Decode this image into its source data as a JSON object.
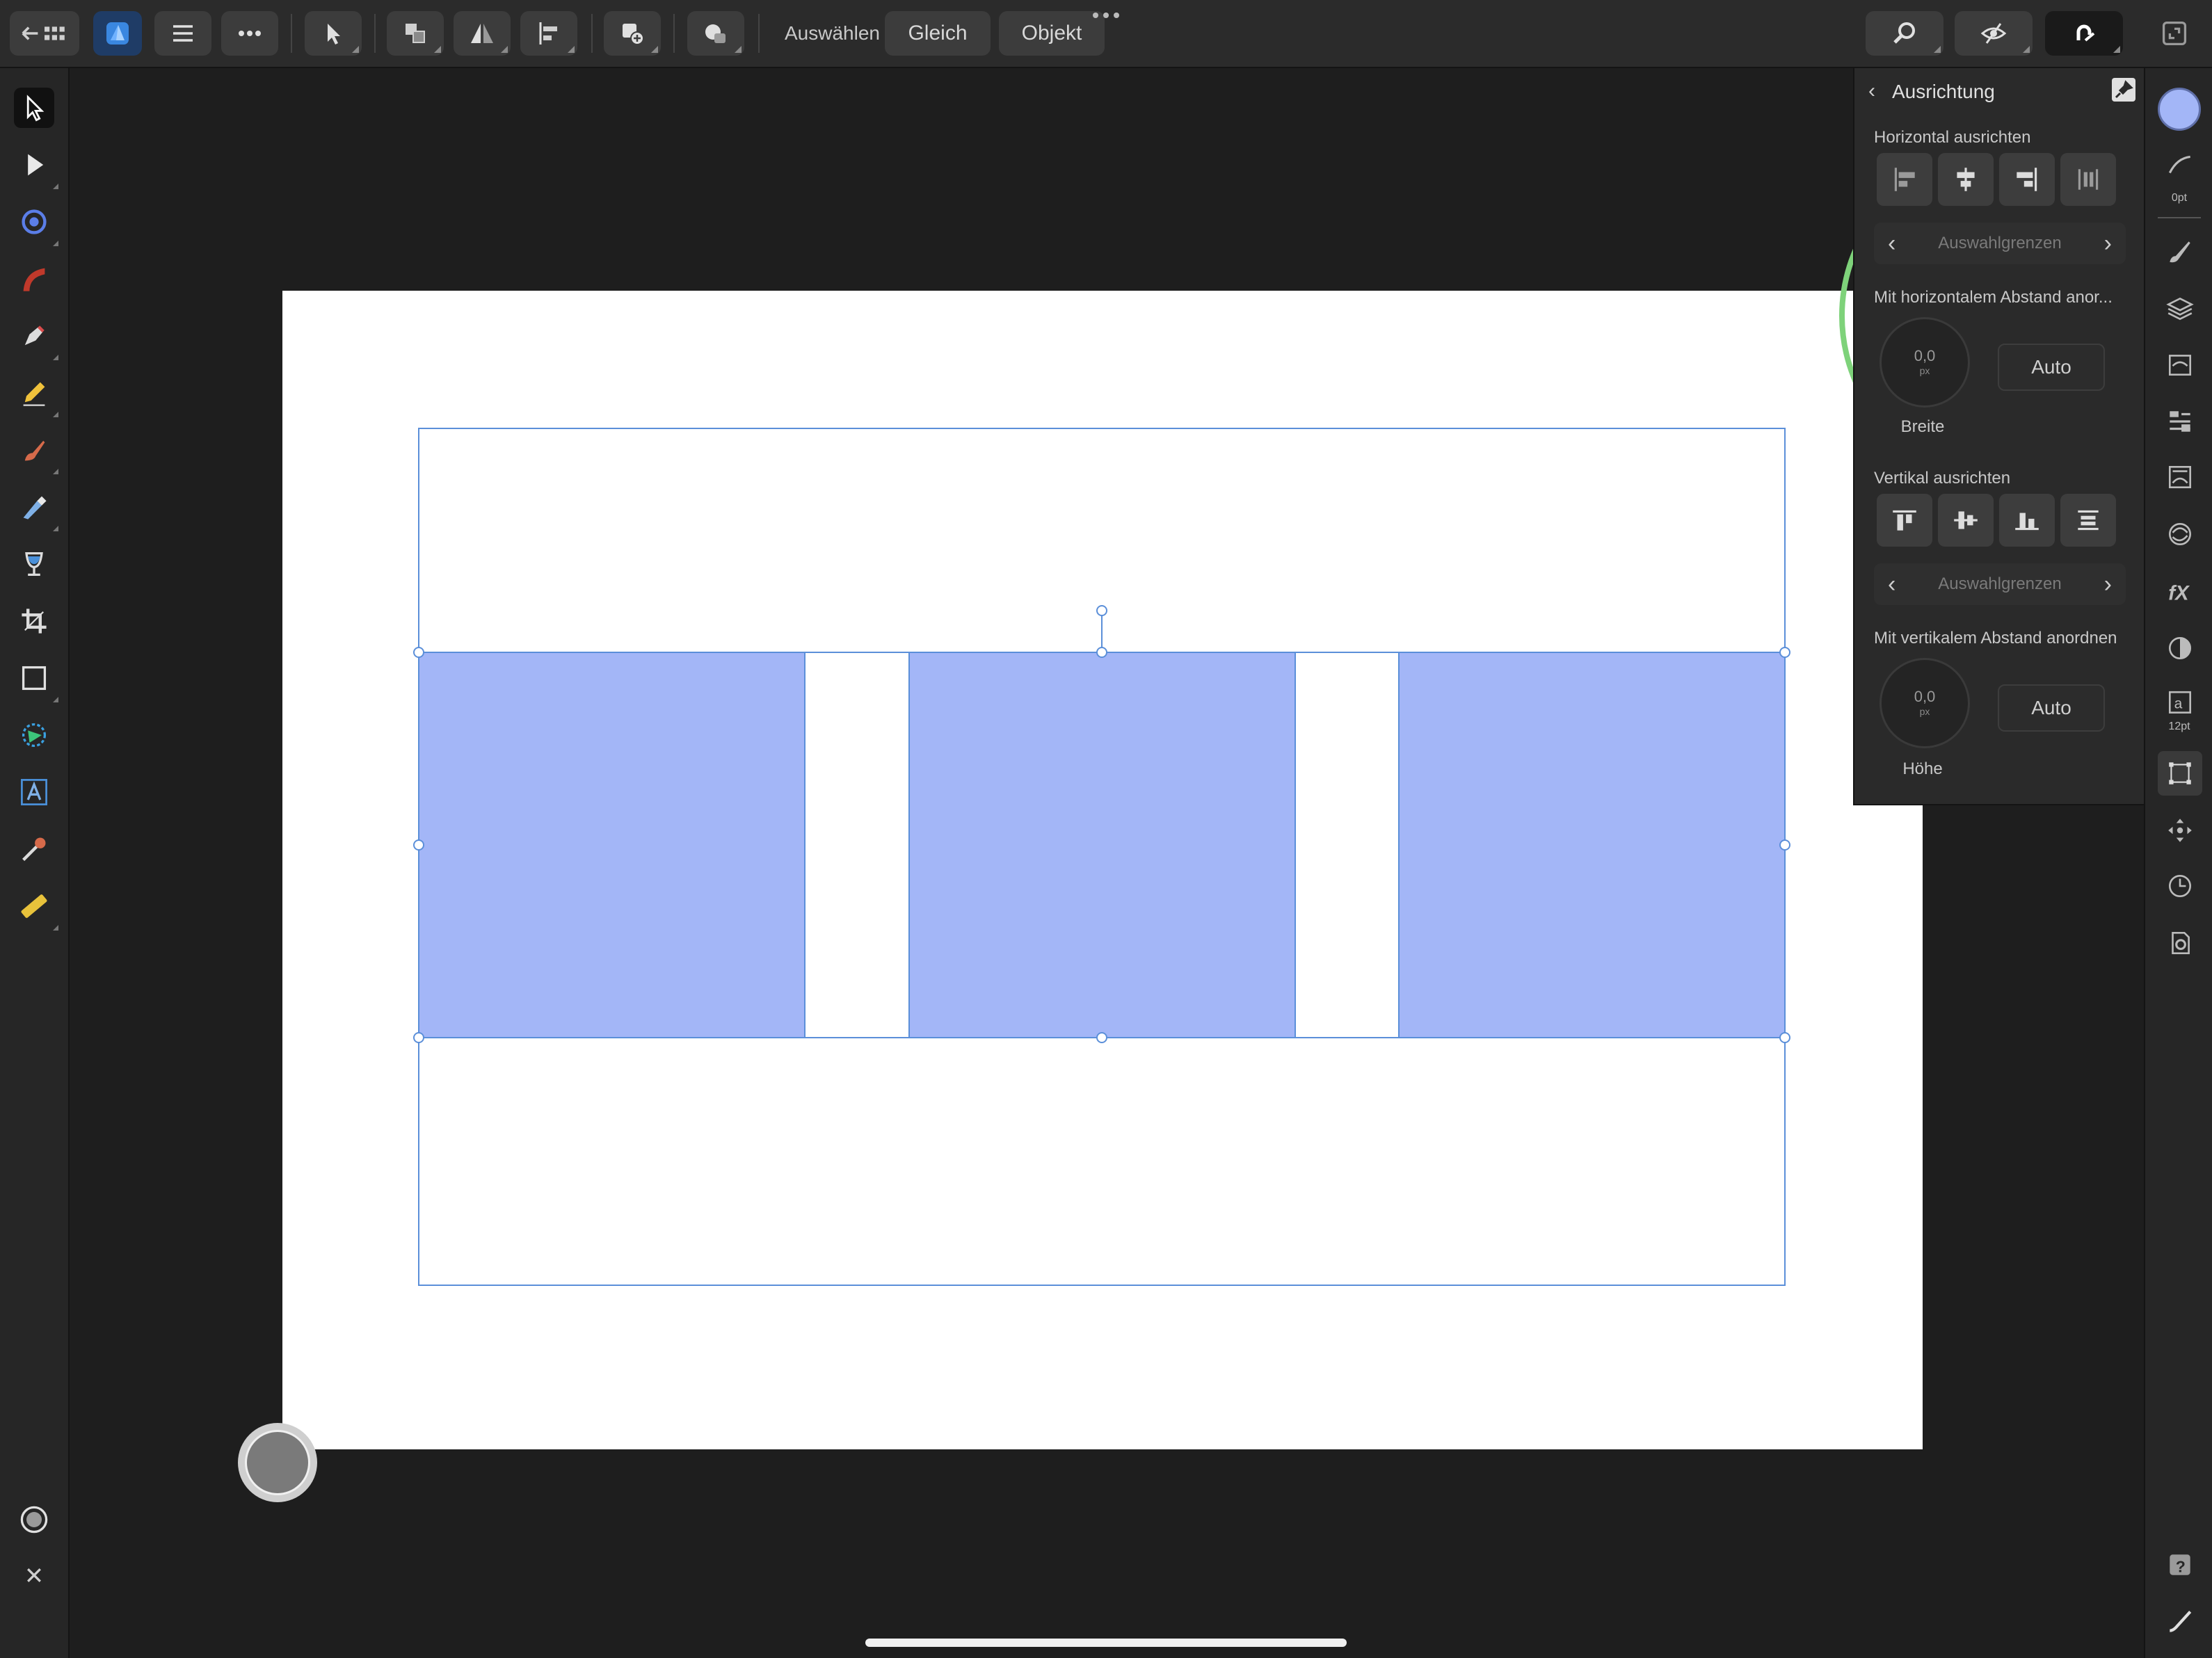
{
  "toolbar": {
    "select_label": "Auswählen",
    "same_button": "Gleich",
    "object_button": "Objekt"
  },
  "panel": {
    "title": "Ausrichtung",
    "horizontal_align_label": "Horizontal ausrichten",
    "horizontal_relative_to": "Auswahlgrenzen",
    "horizontal_spacing_label": "Mit horizontalem Abstand anor...",
    "horizontal_spacing_value": "0,0",
    "horizontal_spacing_unit": "px",
    "horizontal_auto": "Auto",
    "width_label": "Breite",
    "vertical_align_label": "Vertikal ausrichten",
    "vertical_relative_to": "Auswahlgrenzen",
    "vertical_spacing_label": "Mit vertikalem Abstand anordnen",
    "vertical_spacing_value": "0,0",
    "vertical_spacing_unit": "px",
    "vertical_auto": "Auto",
    "height_label": "Höhe"
  },
  "studio": {
    "stroke_width": "0pt",
    "text_size": "12pt"
  },
  "colors": {
    "accent_blue": "#a3b6f7",
    "highlight_circle": "#7ed27a",
    "selection_line": "#5b8fd9",
    "canvas_bg": "#1e1e1e"
  },
  "icons": {
    "top": [
      "back-grid-icon",
      "affinity-designer-logo-icon",
      "menu-icon",
      "more-icon",
      "move-tool-icon",
      "arrange-icon",
      "flip-icon",
      "align-icon",
      "insert-icon",
      "boolean-icon",
      "zoom-icon",
      "view-mode-icon",
      "snapping-icon",
      "fullscreen-icon"
    ],
    "left": [
      "move-icon",
      "node-icon",
      "corner-icon",
      "gradient-icon",
      "pen-icon",
      "pencil-icon",
      "brush-icon",
      "vector-brush-icon",
      "fill-icon",
      "crop-icon",
      "rectangle-icon",
      "shape-icon",
      "text-icon",
      "color-picker-icon",
      "measure-icon",
      "color-wheel-icon",
      "close-icon"
    ],
    "right": [
      "color-swatch-icon",
      "stroke-icon",
      "brushes-icon",
      "layers-icon",
      "appearance-icon",
      "styles-icon",
      "text-styles-icon",
      "stock-icon",
      "fx-icon",
      "adjustments-icon",
      "character-icon",
      "transform-icon",
      "navigator-icon",
      "history-icon",
      "settings-icon",
      "help-icon",
      "quick-menu-icon"
    ]
  }
}
